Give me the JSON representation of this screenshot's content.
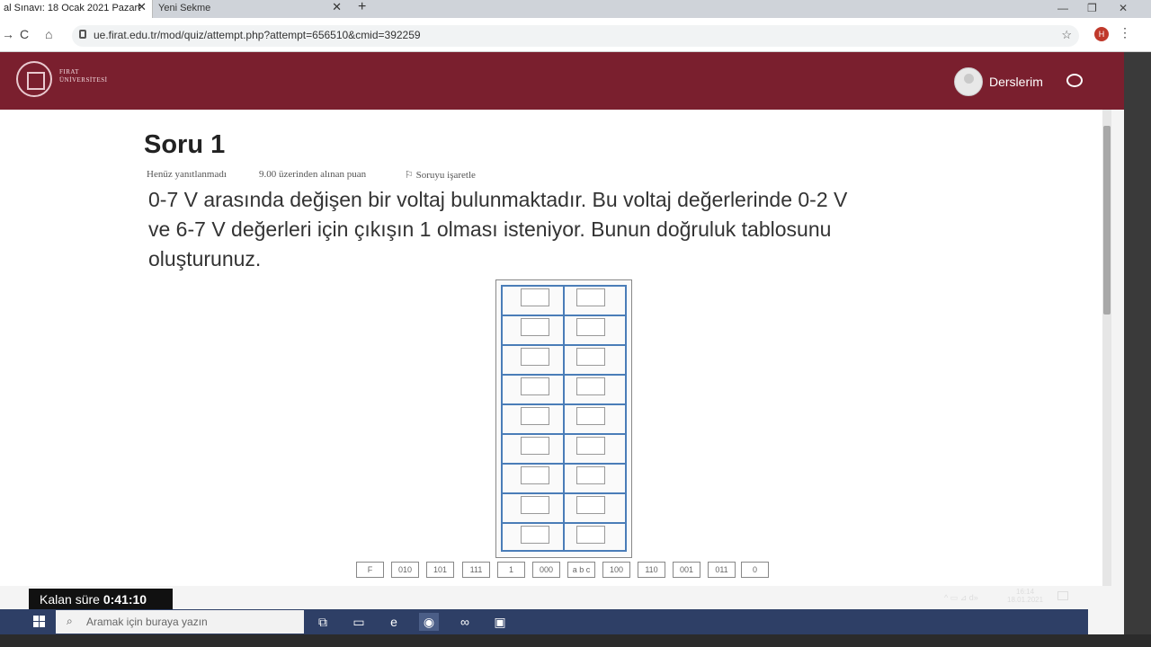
{
  "browser": {
    "tabs": [
      {
        "label": "al Sınavı: 18 Ocak 2021 Pazart",
        "close": "✕"
      },
      {
        "label": "Yeni Sekme",
        "close": "✕"
      }
    ],
    "new_tab": "+",
    "window_controls": [
      "—",
      "❐",
      "✕"
    ],
    "nav": {
      "back": "→",
      "reload": "C",
      "home": "⌂"
    },
    "url": "ue.firat.edu.tr/mod/quiz/attempt.php?attempt=656510&cmid=392259",
    "bookmark_icon": "☆",
    "profile_initial": "H",
    "menu": "⋮"
  },
  "header": {
    "logo_line1": "FIRAT",
    "logo_line2": "ÜNİVERSİTESİ",
    "courses_label": "Derslerim"
  },
  "question": {
    "title": "Soru 1",
    "status": "Henüz yanıtlanmadı",
    "points": "9.00 üzerinden alınan puan",
    "flag_label": "Soruyu işaretle",
    "text_lines": [
      "0-7 V arasında değişen bir voltaj bulunmaktadır. Bu voltaj değerlerinde 0-2 V",
      "ve 6-7 V değerleri için çıkışın 1 olması isteniyor. Bunun doğruluk tablosunu",
      "oluşturunuz."
    ]
  },
  "answer_chips": [
    "F",
    "010",
    "101",
    "111",
    "1",
    "000",
    "a b c",
    "100",
    "110",
    "001",
    "011",
    "0"
  ],
  "timer": {
    "label": "Kalan süre",
    "value": "0:41:10"
  },
  "taskbar": {
    "search_placeholder": "Aramak için buraya yazın",
    "clock_time": "16:14",
    "clock_date": "18.01.2021",
    "tray": "^ ▭ ⊿ d»"
  }
}
